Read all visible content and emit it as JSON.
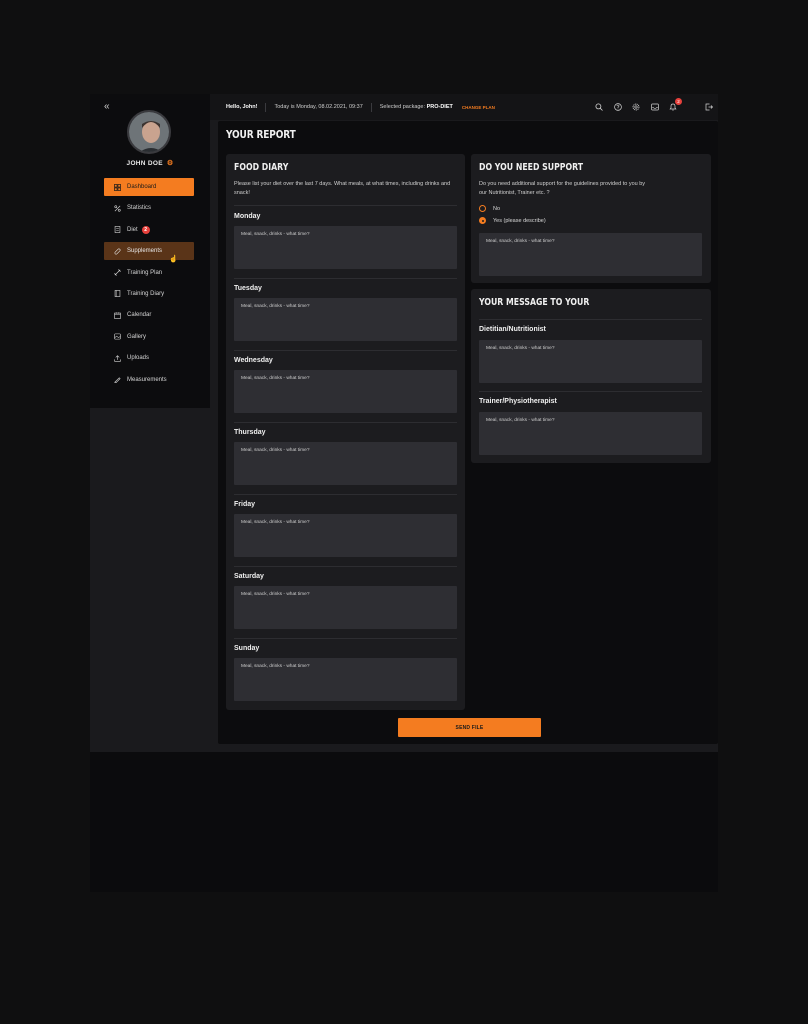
{
  "sidebar": {
    "username": "JOHN DOE",
    "items": [
      {
        "label": "Dashboard",
        "icon": "grid-icon",
        "state": "active"
      },
      {
        "label": "Statistics",
        "icon": "stats-icon"
      },
      {
        "label": "Diet",
        "icon": "diet-icon",
        "badge": "2"
      },
      {
        "label": "Supplements",
        "icon": "pill-icon",
        "state": "hover"
      },
      {
        "label": "Training Plan",
        "icon": "dumbbell-icon"
      },
      {
        "label": "Training Diary",
        "icon": "book-icon"
      },
      {
        "label": "Calendar",
        "icon": "calendar-icon"
      },
      {
        "label": "Gallery",
        "icon": "gallery-icon"
      },
      {
        "label": "Uploads",
        "icon": "upload-icon"
      },
      {
        "label": "Measurements",
        "icon": "ruler-icon"
      }
    ]
  },
  "topbar": {
    "greeting": "Hello, John!",
    "date": "Today is Monday, 08.02.2021, 09:37",
    "package_label": "Selected package:",
    "package_name": "PRO-DIET",
    "change_plan": "CHANGE PLAN",
    "notifications_count": "2"
  },
  "page": {
    "title": "YOUR REPORT",
    "send_button": "SEND FILE"
  },
  "food_diary": {
    "title": "FOOD DIARY",
    "description": "Please list your diet over the last 7 days. What meals, at what times, including drinks and snack!",
    "placeholder": "Meal, snack, drinks - what time?",
    "days": [
      "Monday",
      "Tuesday",
      "Wednesday",
      "Thursday",
      "Friday",
      "Saturday",
      "Sunday"
    ]
  },
  "support": {
    "title": "DO YOU NEED SUPPORT",
    "description": "Do you need additional support for the guidelines provided to you by our Nutritionist, Trainer etc. ?",
    "option_no": "No",
    "option_yes": "Yes (please describe)",
    "selected": "yes",
    "placeholder": "Meal, snack, drinks - what time?"
  },
  "message": {
    "title": "YOUR MESSAGE TO YOUR",
    "dietitian_label": "Dietitian/Nutritionist",
    "trainer_label": "Trainer/Physiotherapist",
    "placeholder": "Meal, snack, drinks - what time?"
  },
  "colors": {
    "accent": "#f47c20",
    "badge": "#e8413c",
    "card": "#1c1c1f",
    "field": "#2e2e33"
  }
}
